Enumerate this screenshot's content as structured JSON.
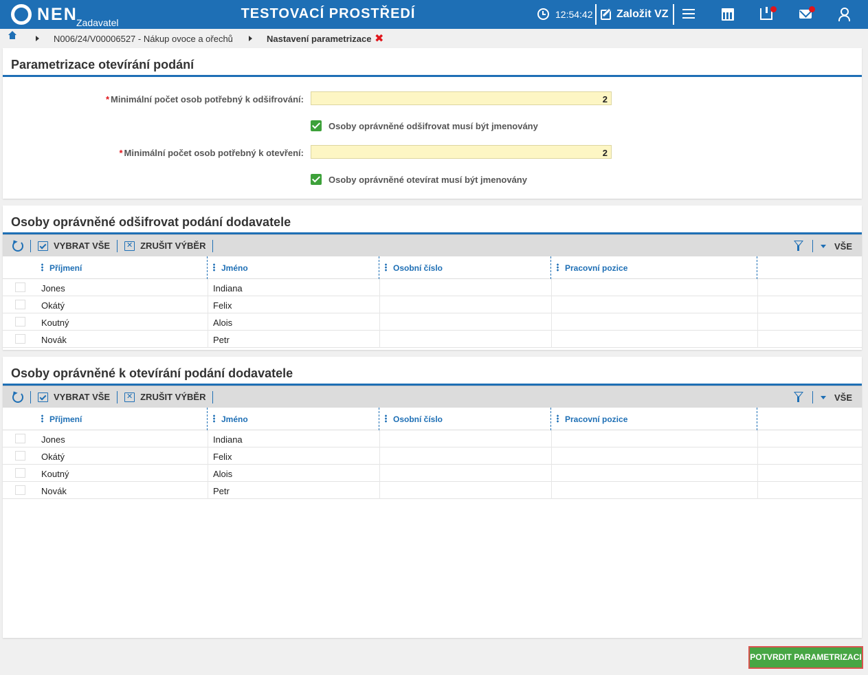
{
  "header": {
    "logo_text": "NEN",
    "logo_sub": "Zadavatel",
    "env_title": "TESTOVACÍ PROSTŘEDÍ",
    "clock": "12:54:42",
    "create_label": "Založit VZ"
  },
  "breadcrumb": {
    "item1": "N006/24/V00006527 - Nákup ovoce a ořechů",
    "current": "Nastavení parametrizace"
  },
  "param_panel": {
    "title": "Parametrizace otevírání podání",
    "decrypt_min_label": "Minimální počet osob potřebný k odšifrování:",
    "decrypt_min_value": "2",
    "decrypt_named_label": "Osoby oprávněné odšifrovat musí být jmenovány",
    "decrypt_named_checked": true,
    "open_min_label": "Minimální počet osob potřebný k otevření:",
    "open_min_value": "2",
    "open_named_label": "Osoby oprávněné otevírat musí být jmenovány",
    "open_named_checked": true
  },
  "toolbar": {
    "select_all": "VYBRAT VŠE",
    "clear_selection": "ZRUŠIT VÝBĚR",
    "filter_all": "VŠE"
  },
  "columns": [
    "Příjmení",
    "Jméno",
    "Osobní číslo",
    "Pracovní pozice"
  ],
  "decrypt_panel": {
    "title": "Osoby oprávněné odšifrovat podání dodavatele",
    "rows": [
      {
        "surname": "Jones",
        "name": "Indiana"
      },
      {
        "surname": "Okátý",
        "name": "Felix"
      },
      {
        "surname": "Koutný",
        "name": "Alois"
      },
      {
        "surname": "Novák",
        "name": "Petr"
      }
    ]
  },
  "open_panel": {
    "title": "Osoby oprávněné k otevírání podání dodavatele",
    "rows": [
      {
        "surname": "Jones",
        "name": "Indiana"
      },
      {
        "surname": "Okátý",
        "name": "Felix"
      },
      {
        "surname": "Koutný",
        "name": "Alois"
      },
      {
        "surname": "Novák",
        "name": "Petr"
      }
    ]
  },
  "footer": {
    "confirm_label": "POTVRDIT PARAMETRIZACI"
  },
  "colors": {
    "primary": "#1e6fb5",
    "input_bg": "#fdf6c4",
    "check_green": "#3da13a",
    "confirm_green": "#47a644",
    "alert_red": "#e0151b"
  }
}
